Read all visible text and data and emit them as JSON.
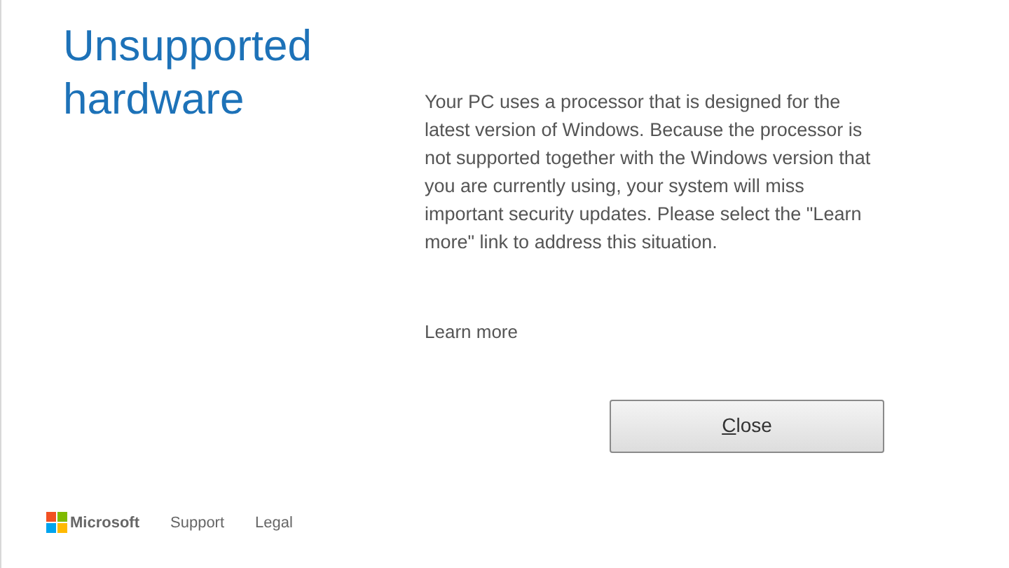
{
  "title": "Unsupported hardware",
  "message": "Your PC uses a processor that is designed for the latest version of Windows. Because the processor is not supported together with the Windows version that you are currently using, your system will miss important security updates. Please select the \"Learn more\" link to address this situation.",
  "learn_more_link": "Learn more",
  "close_button": {
    "label": "Close",
    "mnemonic": true
  },
  "footer": {
    "brand": "Microsoft",
    "links": [
      "Support",
      "Legal"
    ]
  }
}
